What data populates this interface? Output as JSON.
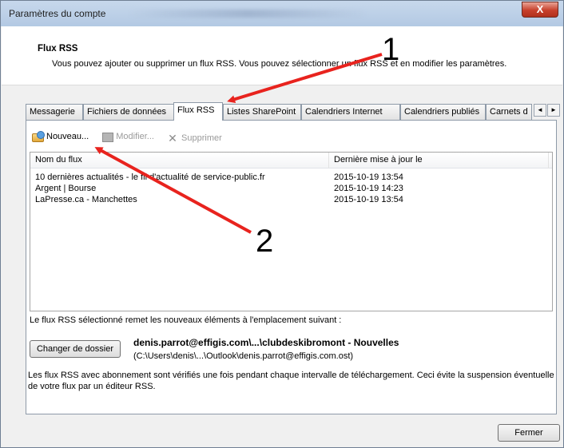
{
  "window": {
    "title": "Paramètres du compte",
    "close_glyph": "X"
  },
  "header": {
    "title": "Flux RSS",
    "description": "Vous pouvez ajouter ou supprimer un flux RSS. Vous pouvez sélectionner un flux RSS et en modifier les paramètres."
  },
  "tabs": [
    {
      "label": "Messagerie"
    },
    {
      "label": "Fichiers de données"
    },
    {
      "label": "Flux RSS"
    },
    {
      "label": "Listes SharePoint"
    },
    {
      "label": "Calendriers Internet"
    },
    {
      "label": "Calendriers publiés"
    },
    {
      "label": "Carnets d"
    }
  ],
  "tab_scroll": {
    "left": "◄",
    "right": "►"
  },
  "toolbar": {
    "new_label": "Nouveau...",
    "modify_label": "Modifier...",
    "delete_label": "Supprimer",
    "delete_glyph": "✕"
  },
  "list": {
    "columns": [
      "Nom du flux",
      "Dernière mise à jour le"
    ],
    "rows": [
      {
        "name": "10 dernières actualités - le fil d'actualité de service-public.fr",
        "updated": "2015-10-19 13:54"
      },
      {
        "name": "Argent | Bourse",
        "updated": "2015-10-19 14:23"
      },
      {
        "name": "LaPresse.ca - Manchettes",
        "updated": "2015-10-19 13:54"
      }
    ]
  },
  "delivery": {
    "info": "Le flux RSS sélectionné remet les nouveaux éléments à l'emplacement suivant :",
    "change_button": "Changer de dossier",
    "folder_name": "denis.parrot@effigis.com\\...\\clubdeskibromont - Nouvelles",
    "folder_path": "(C:\\Users\\denis\\...\\Outlook\\denis.parrot@effigis.com.ost)"
  },
  "footnote": "Les flux RSS avec abonnement sont vérifiés une fois pendant chaque intervalle de téléchargement. Ceci évite la suspension éventuelle de votre flux par un éditeur RSS.",
  "footer": {
    "close_button": "Fermer"
  },
  "annotations": {
    "label_1": "1",
    "label_2": "2",
    "arrow_color": "#e8231e"
  }
}
